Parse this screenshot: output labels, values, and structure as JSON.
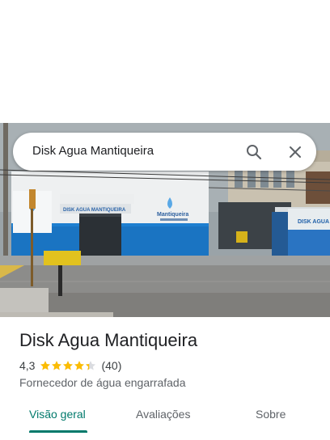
{
  "search": {
    "query": "Disk Agua Mantiqueira",
    "search_icon": "search-icon",
    "close_icon": "close-icon"
  },
  "photo": {
    "sign_main": "DISK AGUA MANTIQUEIRA",
    "sign_right": "DISK AGUA",
    "logo_text": "Mantiqueira"
  },
  "place": {
    "title": "Disk Agua Mantiqueira",
    "rating": "4,3",
    "stars_value": 4.3,
    "reviews": "(40)",
    "category": "Fornecedor de água engarrafada"
  },
  "tabs": [
    {
      "label": "Visão geral",
      "active": true
    },
    {
      "label": "Avaliações",
      "active": false
    },
    {
      "label": "Sobre",
      "active": false
    }
  ],
  "colors": {
    "accent": "#00796b",
    "star": "#fbbc04",
    "building_blue": "#1e7fd0"
  }
}
